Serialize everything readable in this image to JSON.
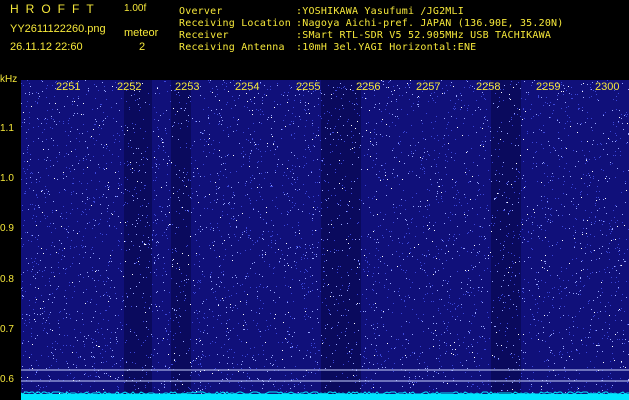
{
  "header": {
    "app_title": "HROFFT",
    "version": "1.00f",
    "file_name": "YY2611122260.png",
    "datetime": "26.11.12 22:60",
    "counter_label": "meteor",
    "counter_value": "2"
  },
  "station": {
    "rows": [
      {
        "label": "Overver",
        "value": ":YOSHIKAWA Yasufumi /JG2MLI"
      },
      {
        "label": "Receiving Location",
        "value": ":Nagoya Aichi-pref. JAPAN (136.90E, 35.20N)"
      },
      {
        "label": "Receiver",
        "value": ":SMart RTL-SDR V5 52.905MHz USB TACHIKAWA"
      },
      {
        "label": "Receiving Antenna",
        "value": ":10mH 3el.YAGI Horizontal:ENE"
      }
    ]
  },
  "axis": {
    "unit": "kHz",
    "y_ticks": [
      "1.1",
      "1.0",
      "0.9",
      "0.8",
      "0.7",
      "0.6"
    ],
    "x_ticks": [
      "2251",
      "2252",
      "2253",
      "2254",
      "2255",
      "2256",
      "2257",
      "2258",
      "2259",
      "2300"
    ]
  },
  "colors": {
    "text": "#f6e83a",
    "background": "#000000",
    "waterfall_base": "#10107a",
    "noise_dot": "#9aa8ff",
    "marker_line": "#c8d2ff",
    "spectrum_baseline": "#00e6ff"
  }
}
